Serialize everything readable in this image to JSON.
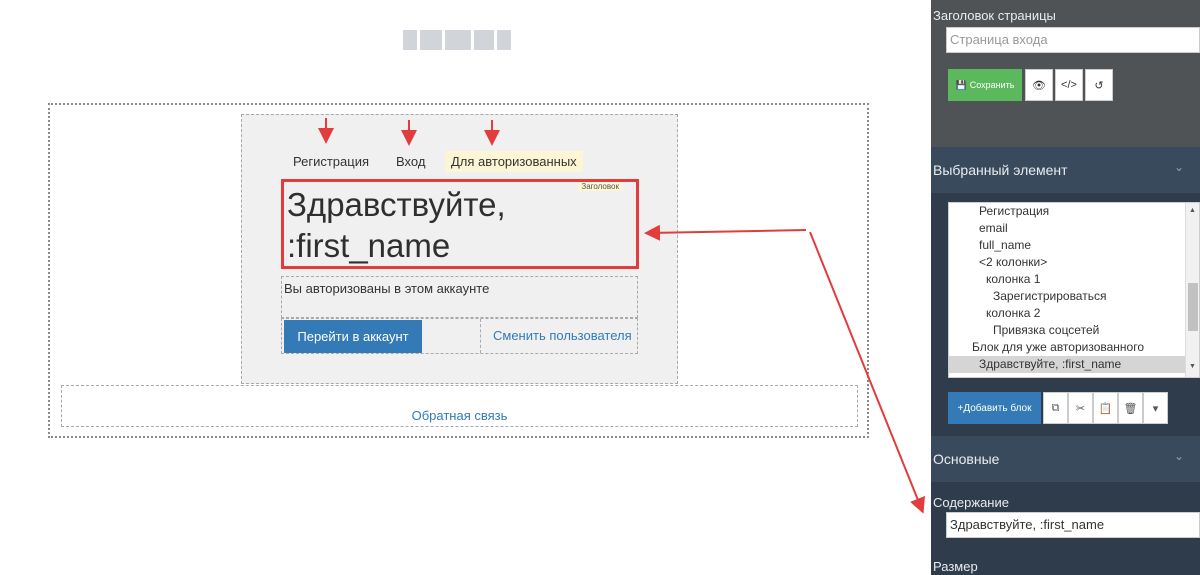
{
  "canvas": {
    "nav": {
      "register": "Регистрация",
      "login": "Вход",
      "authorized": "Для авторизованных"
    },
    "heading": {
      "tag": "Заголовок",
      "line1": "Здравствуйте,",
      "line2": ":first_name"
    },
    "description": "Вы авторизованы в этом аккаунте",
    "go_to_account_button": "Перейти в аккаунт",
    "switch_user_link": "Сменить пользователя",
    "feedback_link": "Обратная связь"
  },
  "panel": {
    "page_title_label": "Заголовок страницы",
    "page_title_placeholder": "Страница входа",
    "save_button": "Сохранить",
    "selected_element_header": "Выбранный элемент",
    "tree_items": [
      "Регистрация",
      "email",
      "full_name",
      "<2 колонки>",
      "колонка 1",
      "Зарегистрироваться",
      "колонка 2",
      "Привязка соцсетей",
      "Блок для уже авторизованного",
      "Здравствуйте, :first_name"
    ],
    "add_block_button": "+Добавить блок",
    "main_section_header": "Основные",
    "content_label": "Содержание",
    "content_value": "Здравствуйте, :first_name",
    "size_label": "Размер"
  },
  "colors": {
    "accent_blue": "#337ab7",
    "save_green": "#5cb85c",
    "highlight_red": "#e23c3c",
    "panel_bg": "#2f3c4c"
  }
}
